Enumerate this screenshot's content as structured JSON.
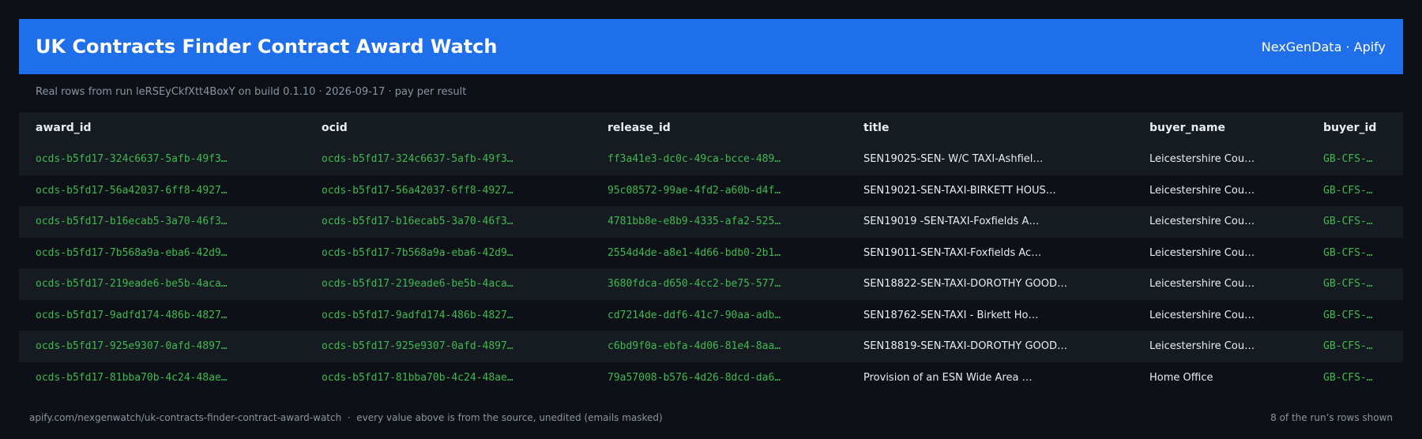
{
  "header": {
    "title": "UK Contracts Finder Contract Award Watch",
    "brand": "NexGenData · Apify"
  },
  "subtitle": "Real rows from run leRSEyCkfXtt4BoxY on build 0.1.10 · 2026-09-17 · pay per result",
  "table": {
    "columns": [
      "award_id",
      "ocid",
      "release_id",
      "title",
      "buyer_name",
      "buyer_id"
    ],
    "rows": [
      [
        "ocds-b5fd17-324c6637-5afb-49f3…",
        "ocds-b5fd17-324c6637-5afb-49f3…",
        "ff3a41e3-dc0c-49ca-bcce-489…",
        "SEN19025-SEN- W/C TAXI-Ashfiel…",
        "Leicestershire Cou…",
        "GB-CFS-…"
      ],
      [
        "ocds-b5fd17-56a42037-6ff8-4927…",
        "ocds-b5fd17-56a42037-6ff8-4927…",
        "95c08572-99ae-4fd2-a60b-d4f…",
        "SEN19021-SEN-TAXI-BIRKETT HOUS…",
        "Leicestershire Cou…",
        "GB-CFS-…"
      ],
      [
        "ocds-b5fd17-b16ecab5-3a70-46f3…",
        "ocds-b5fd17-b16ecab5-3a70-46f3…",
        "4781bb8e-e8b9-4335-afa2-525…",
        "SEN19019 -SEN-TAXI-Foxfields A…",
        "Leicestershire Cou…",
        "GB-CFS-…"
      ],
      [
        "ocds-b5fd17-7b568a9a-eba6-42d9…",
        "ocds-b5fd17-7b568a9a-eba6-42d9…",
        "2554d4de-a8e1-4d66-bdb0-2b1…",
        "SEN19011-SEN-TAXI-Foxfields Ac…",
        "Leicestershire Cou…",
        "GB-CFS-…"
      ],
      [
        "ocds-b5fd17-219eade6-be5b-4aca…",
        "ocds-b5fd17-219eade6-be5b-4aca…",
        "3680fdca-d650-4cc2-be75-577…",
        "SEN18822-SEN-TAXI-DOROTHY GOOD…",
        "Leicestershire Cou…",
        "GB-CFS-…"
      ],
      [
        "ocds-b5fd17-9adfd174-486b-4827…",
        "ocds-b5fd17-9adfd174-486b-4827…",
        "cd7214de-ddf6-41c7-90aa-adb…",
        "SEN18762-SEN-TAXI - Birkett Ho…",
        "Leicestershire Cou…",
        "GB-CFS-…"
      ],
      [
        "ocds-b5fd17-925e9307-0afd-4897…",
        "ocds-b5fd17-925e9307-0afd-4897…",
        "c6bd9f0a-ebfa-4d06-81e4-8aa…",
        "SEN18819-SEN-TAXI-DOROTHY GOOD…",
        "Leicestershire Cou…",
        "GB-CFS-…"
      ],
      [
        "ocds-b5fd17-81bba70b-4c24-48ae…",
        "ocds-b5fd17-81bba70b-4c24-48ae…",
        "79a57008-b576-4d26-8dcd-da6…",
        "Provision of an ESN Wide Area …",
        "Home Office",
        "GB-CFS-…"
      ]
    ]
  },
  "footer": {
    "source": "apify.com/nexgenwatch/uk-contracts-finder-contract-award-watch  ·  every value above is from the source, unedited (emails masked)",
    "count": "8 of the run’s rows shown"
  },
  "colors": {
    "background": "#0d1117",
    "header": "#1f6feb",
    "id_text": "#3fb950",
    "muted_text": "#8b949e"
  }
}
